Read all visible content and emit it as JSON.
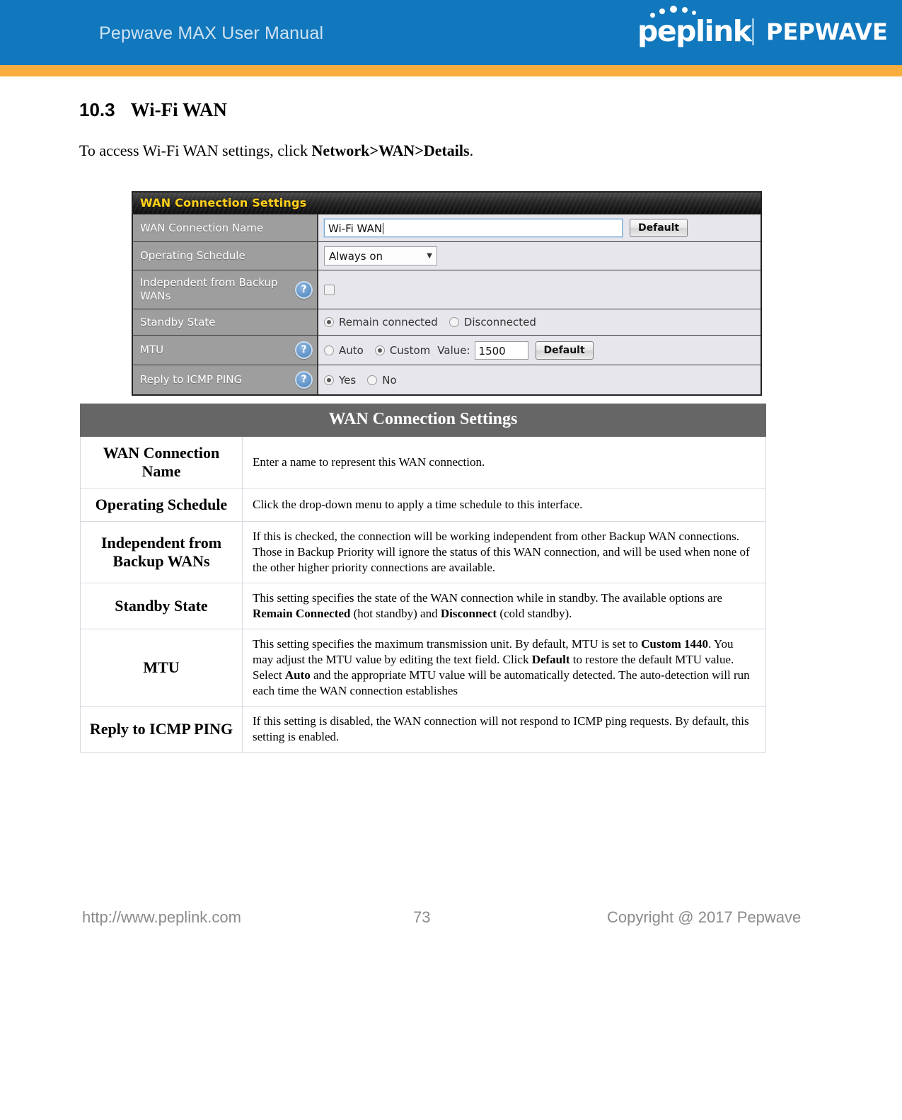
{
  "header": {
    "manual_title": "Pepwave MAX User Manual",
    "logo_primary": "peplink",
    "logo_secondary": "PEPWAVE",
    "band_color": "#1278be",
    "stripe_color": "#f9ad3c"
  },
  "section": {
    "number": "10.3",
    "title": "Wi-Fi WAN",
    "intro_prefix": "To access Wi-Fi WAN settings, click ",
    "intro_bold": "Network>WAN>Details",
    "intro_suffix": "."
  },
  "ui_panel": {
    "title": "WAN Connection Settings",
    "title_text_color": "#ffd11a",
    "label_bg_color": "#9e9e9e",
    "value_bg_color": "#e6e6ec",
    "rows": [
      {
        "label": "WAN Connection Name",
        "help": false,
        "input_value": "Wi-Fi WAN",
        "button": "Default"
      },
      {
        "label": "Operating Schedule",
        "help": false,
        "select_value": "Always on",
        "select_arrow": "▼"
      },
      {
        "label": "Independent from Backup WANs",
        "help": true,
        "help_glyph": "?",
        "checkbox_checked": false
      },
      {
        "label": "Standby State",
        "help": false,
        "options": [
          {
            "label": "Remain connected",
            "selected": true
          },
          {
            "label": "Disconnected",
            "selected": false
          }
        ]
      },
      {
        "label": "MTU",
        "help": true,
        "help_glyph": "?",
        "options": [
          {
            "label": "Auto",
            "selected": false
          },
          {
            "label": "Custom",
            "selected": true
          }
        ],
        "value_label": "Value:",
        "value_field": "1500",
        "button": "Default"
      },
      {
        "label": "Reply to ICMP PING",
        "help": true,
        "help_glyph": "?",
        "options": [
          {
            "label": "Yes",
            "selected": true
          },
          {
            "label": "No",
            "selected": false
          }
        ]
      }
    ]
  },
  "doc_table": {
    "caption": "WAN Connection Settings",
    "header_bg": "#666666",
    "rows": [
      {
        "term": "WAN Connection Name",
        "desc": "Enter a name to represent this WAN connection."
      },
      {
        "term": "Operating Schedule",
        "desc": "Click the drop-down menu to apply a time schedule to this interface."
      },
      {
        "term": "Independent from Backup WANs",
        "desc": "If this is checked, the connection will be working independent from other Backup WAN connections. Those in Backup Priority will ignore the status of this WAN connection, and will be used when none of the other higher priority connections are available."
      },
      {
        "term": "Standby State",
        "desc_html": "This setting specifies the state of the WAN connection while in standby. The available options are <b>Remain Connected</b> (hot standby) and <b>Disconnect</b> (cold standby)."
      },
      {
        "term": "MTU",
        "desc_html": "This setting specifies the maximum transmission unit. By default, MTU is set to <b>Custom 1440</b>. You may adjust the MTU value by editing the text field. Click <b>Default</b> to restore the default MTU value. Select <b>Auto</b> and the appropriate MTU value will be automatically detected. The auto-detection will run each time the WAN connection establishes"
      },
      {
        "term": "Reply to ICMP PING",
        "desc": "If this setting is disabled, the WAN connection will not respond to ICMP ping requests. By default, this setting is enabled."
      }
    ]
  },
  "footer": {
    "url": "http://www.peplink.com",
    "page_number": "73",
    "copyright": "Copyright @ 2017 Pepwave"
  }
}
